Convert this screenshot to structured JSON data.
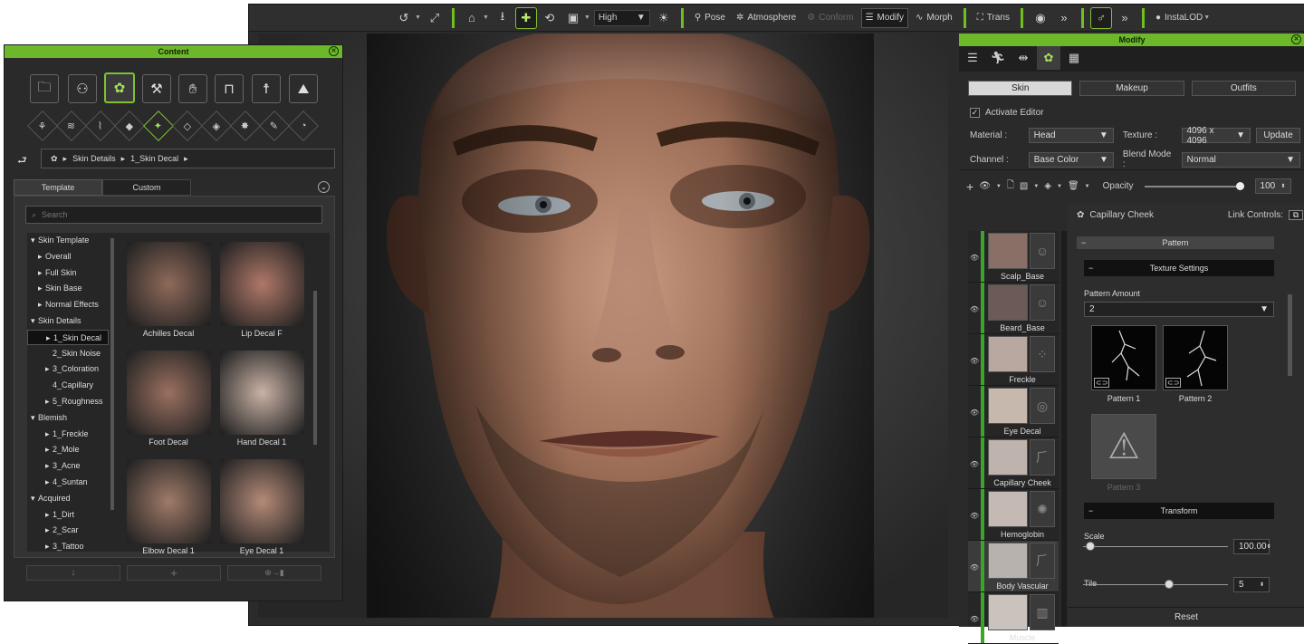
{
  "toolbar": {
    "quality": "High",
    "pose": "Pose",
    "atmosphere": "Atmosphere",
    "conform": "Conform",
    "modify": "Modify",
    "morph": "Morph",
    "trans": "Trans",
    "instalod": "InstaLOD",
    "more": "»"
  },
  "modify_panel": {
    "title": "Modify",
    "segments": [
      "Skin",
      "Makeup",
      "Outfits"
    ],
    "activate_editor": "Activate Editor",
    "material_label": "Material :",
    "material_value": "Head",
    "texture_label": "Texture :",
    "texture_value": "4096 x 4096",
    "update": "Update",
    "channel_label": "Channel :",
    "channel_value": "Base Color",
    "blend_label": "Blend Mode :",
    "blend_value": "Normal",
    "opacity_label": "Opacity",
    "opacity_value": "100",
    "opacity_fraction": 0.98
  },
  "skin_items": [
    {
      "label": "Scalp_Base",
      "icon": "head-outline-icon"
    },
    {
      "label": "Beard_Base",
      "icon": "head-outline-icon"
    },
    {
      "label": "Freckle",
      "icon": "dots-icon"
    },
    {
      "label": "Eye Decal",
      "icon": "eye-outline-icon"
    },
    {
      "label": "Capillary Cheek",
      "icon": "capillary-icon"
    },
    {
      "label": "Hemoglobin",
      "icon": "splash-icon"
    },
    {
      "label": "Body Vascular",
      "icon": "vascular-icon"
    },
    {
      "label": "Muscle",
      "icon": "torso-icon"
    }
  ],
  "detail": {
    "name": "Capillary Cheek",
    "link_controls": "Link Controls:",
    "pattern": "Pattern",
    "texture_settings": "Texture Settings",
    "pattern_amount_label": "Pattern Amount",
    "pattern_amount_value": "2",
    "patterns": [
      "Pattern 1",
      "Pattern 2",
      "Pattern 3"
    ],
    "transform": "Transform",
    "scale_label": "Scale",
    "scale_value": "100.00",
    "scale_fraction": 0.02,
    "tile_label": "Tile",
    "tile_value": "5",
    "tile_fraction": 0.58,
    "reset": "Reset"
  },
  "content_panel": {
    "title": "Content",
    "breadcrumb": [
      "Skin Details",
      "1_Skin Decal"
    ],
    "tabs": [
      "Template",
      "Custom"
    ],
    "search_placeholder": "Search",
    "tree": [
      {
        "label": "Skin Template",
        "level": 0,
        "arrow": "down"
      },
      {
        "label": "Overall",
        "level": 1,
        "arrow": "right"
      },
      {
        "label": "Full Skin",
        "level": 1,
        "arrow": "right"
      },
      {
        "label": "Skin Base",
        "level": 1,
        "arrow": "right"
      },
      {
        "label": "Normal Effects",
        "level": 1,
        "arrow": "right"
      },
      {
        "label": "Skin Details",
        "level": 0,
        "arrow": "down"
      },
      {
        "label": "1_Skin Decal",
        "level": 2,
        "arrow": "right",
        "selected": true
      },
      {
        "label": "2_Skin Noise",
        "level": 2,
        "arrow": ""
      },
      {
        "label": "3_Coloration",
        "level": 2,
        "arrow": "right"
      },
      {
        "label": "4_Capillary",
        "level": 2,
        "arrow": ""
      },
      {
        "label": "5_Roughness",
        "level": 2,
        "arrow": "right"
      },
      {
        "label": "Blemish",
        "level": 0,
        "arrow": "down"
      },
      {
        "label": "1_Freckle",
        "level": 2,
        "arrow": "right"
      },
      {
        "label": "2_Mole",
        "level": 2,
        "arrow": "right"
      },
      {
        "label": "3_Acne",
        "level": 2,
        "arrow": "right"
      },
      {
        "label": "4_Suntan",
        "level": 2,
        "arrow": "right"
      },
      {
        "label": "Acquired",
        "level": 0,
        "arrow": "down"
      },
      {
        "label": "1_Dirt",
        "level": 2,
        "arrow": "right"
      },
      {
        "label": "2_Scar",
        "level": 2,
        "arrow": "right"
      },
      {
        "label": "3_Tattoo",
        "level": 2,
        "arrow": "right"
      }
    ],
    "thumbnails": [
      "Achilles Decal",
      "Lip Decal F",
      "Foot Decal",
      "Hand Decal 1",
      "Elbow Decal 1",
      "Eye Decal 1"
    ]
  }
}
